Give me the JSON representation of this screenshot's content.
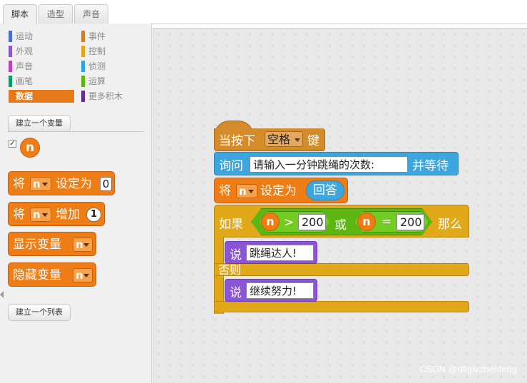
{
  "tabs": [
    {
      "label": "脚本",
      "active": true
    },
    {
      "label": "造型",
      "active": false
    },
    {
      "label": "声音",
      "active": false
    }
  ],
  "categories": [
    {
      "label": "运动",
      "color": "#4a6cd4"
    },
    {
      "label": "外观",
      "color": "#8a55d7"
    },
    {
      "label": "声音",
      "color": "#bb42c3"
    },
    {
      "label": "画笔",
      "color": "#0e9a6c"
    },
    {
      "label": "数据",
      "color": "#ee7d16",
      "selected": true
    },
    {
      "label": "事件",
      "color": "#c88330"
    },
    {
      "label": "控制",
      "color": "#e1a91a"
    },
    {
      "label": "侦测",
      "color": "#2ca5e2"
    },
    {
      "label": "运算",
      "color": "#5cb712"
    },
    {
      "label": "更多积木",
      "color": "#632d99"
    }
  ],
  "palette": {
    "make_variable": "建立一个变量",
    "variable_name": "n",
    "variable_checked": "✓",
    "set_block": {
      "prefix": "将",
      "var": "n",
      "mid": "设定为",
      "value": "0"
    },
    "change_block": {
      "prefix": "将",
      "var": "n",
      "mid": "增加",
      "value": "1"
    },
    "show_block": {
      "label": "显示变量",
      "var": "n"
    },
    "hide_block": {
      "label": "隐藏变量",
      "var": "n"
    },
    "make_list": "建立一个列表"
  },
  "script": {
    "hat": {
      "prefix": "当按下",
      "key": "空格",
      "suffix": "键"
    },
    "ask": {
      "prefix": "询问",
      "question": "请输入一分钟跳绳的次数:",
      "suffix": "并等待"
    },
    "set": {
      "prefix": "将",
      "var": "n",
      "mid": "设定为",
      "value": "回答"
    },
    "if": {
      "prefix": "如果",
      "left_var": "n",
      "op1": ">",
      "val1": "200",
      "or": "或",
      "right_var": "n",
      "op2": "=",
      "val2": "200",
      "suffix": "那么"
    },
    "say1": {
      "label": "说",
      "text": "跳绳达人!"
    },
    "else": "否则",
    "say2": {
      "label": "说",
      "text": "继续努力!"
    }
  },
  "watermark": "CSDN @dllglvzhenfeng"
}
